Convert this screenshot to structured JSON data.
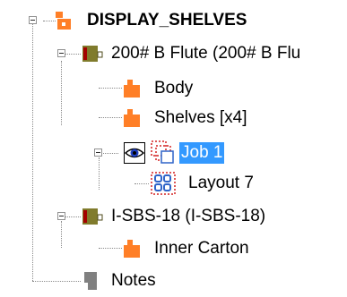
{
  "tree": {
    "root": {
      "label": "DISPLAY_SHELVES",
      "icon": "assembly-icon"
    },
    "nodes": [
      {
        "label": "200# B Flute (200# B Flu",
        "icon": "board-grade-icon"
      },
      {
        "label": "Body",
        "icon": "part-icon"
      },
      {
        "label": "Shelves [x4]",
        "icon": "part-icon"
      },
      {
        "label": "Job 1",
        "icon": "job-icon",
        "extra_icon": "visibility-eye-icon",
        "selected": true
      },
      {
        "label": "Layout 7",
        "icon": "layout-icon"
      },
      {
        "label": "I-SBS-18 (I-SBS-18)",
        "icon": "board-grade-icon"
      },
      {
        "label": "Inner Carton",
        "icon": "part-icon"
      },
      {
        "label": "Notes",
        "icon": "notes-icon"
      }
    ]
  },
  "colors": {
    "selection": "#3399ff",
    "part_orange": "#ff7f27",
    "board_olive": "#807b2c",
    "board_red": "#a40000",
    "layout_blue": "#2f64c8",
    "notes_gray": "#808080",
    "job_red": "#d42020"
  }
}
